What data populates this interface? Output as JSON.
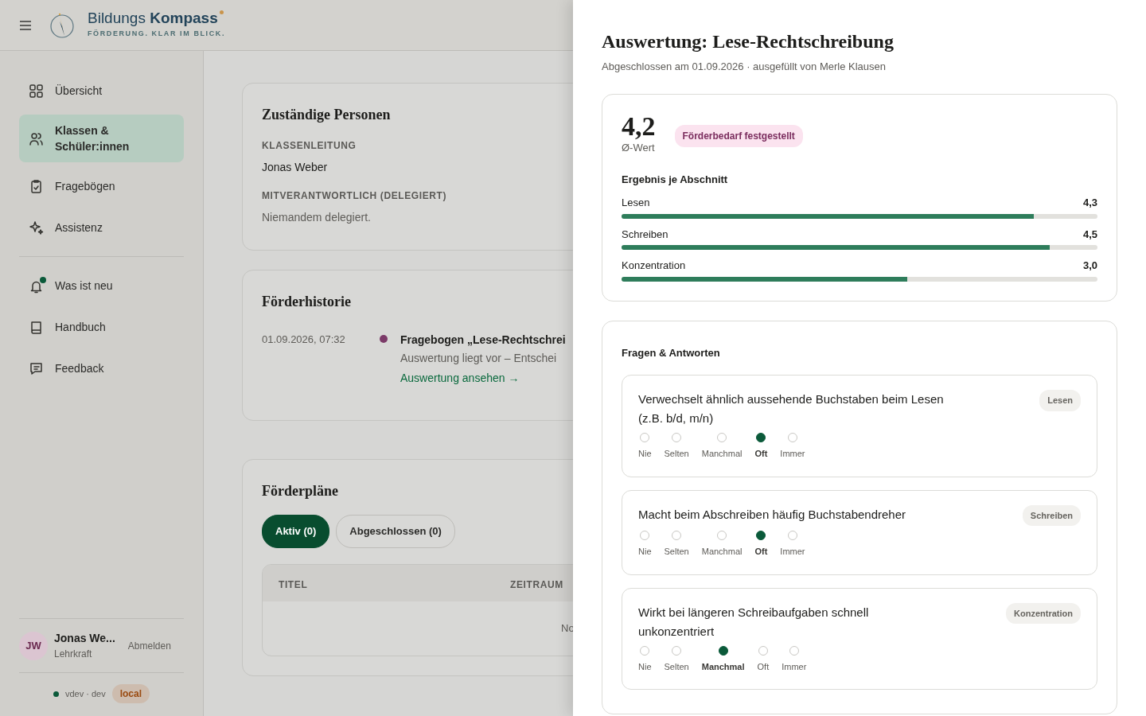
{
  "header": {
    "brand": "Bildungs **Kompass**",
    "tagline": "FÖRDERUNG. KLAR IM BLICK."
  },
  "sidebar": {
    "items": [
      {
        "label": "Übersicht",
        "selected": false,
        "has_news": false
      },
      {
        "label": "Klassen & Schüler:innen",
        "selected": true,
        "has_news": false
      },
      {
        "label": "Fragebögen",
        "selected": false,
        "has_news": false
      },
      {
        "label": "Assistenz",
        "selected": false,
        "has_news": false
      },
      {
        "label": "Was ist neu",
        "selected": false,
        "has_news": true
      },
      {
        "label": "Handbuch",
        "selected": false,
        "has_news": false
      },
      {
        "label": "Feedback",
        "selected": false,
        "has_news": false
      }
    ],
    "user": {
      "initials": "JW",
      "name": "Jonas We...",
      "role": "Lehrkraft",
      "logout": "Abmelden"
    },
    "build": {
      "version": "vdev · dev",
      "environment": "local"
    }
  },
  "persons": {
    "title": "Zuständige Personen",
    "fields": [
      {
        "label": "KLASSENLEITUNG",
        "value": "Jonas Weber",
        "muted": false
      },
      {
        "label": "MITVERANTWORTLICH (DELEGIERT)",
        "value": "Niemandem delegiert.",
        "muted": true
      }
    ]
  },
  "history": {
    "title": "Förderhistorie",
    "entries": [
      {
        "time": "01.09.2026, 07:32",
        "color": "#7b3a68",
        "title": "Fragebogen „Lese-Rechtschrei",
        "text": "Auswertung liegt vor – Entschei",
        "link": "Auswertung ansehen →"
      }
    ]
  },
  "plans": {
    "title": "Förderpläne",
    "filters": [
      {
        "label": "Aktiv (0)",
        "selected": true
      },
      {
        "label": "Abgeschlossen (0)",
        "selected": false
      }
    ],
    "table": {
      "columns": [
        "TITEL",
        "ZEITRAUM"
      ],
      "empty_text": "No"
    }
  },
  "drawer": {
    "title": "Auswertung: Lese-Rechtschreibung",
    "subtitle": "Abgeschlossen am 01.09.2026 · ausgefüllt von Merle Klausen",
    "score": "4,2",
    "score_label": "Ø-Wert",
    "status": "Förderbedarf festgestellt",
    "sections_title": "Ergebnis je Abschnitt",
    "sections": [
      {
        "name": "Lesen",
        "value": "4,3",
        "level": 0.866
      },
      {
        "name": "Schreiben",
        "value": "4,5",
        "level": 0.9
      },
      {
        "name": "Konzentration",
        "value": "3,0",
        "level": 0.6
      }
    ],
    "questions_title": "Fragen & Antworten",
    "questions": [
      {
        "text": "Verwechselt ähnlich aussehende Buchstaben beim Lesen (z.B. b/d, m/n)",
        "tag": "Lesen",
        "options": [
          {
            "label": "Nie",
            "selected": false
          },
          {
            "label": "Selten",
            "selected": false
          },
          {
            "label": "Manchmal",
            "selected": false
          },
          {
            "label": "Oft",
            "selected": true
          },
          {
            "label": "Immer",
            "selected": false
          }
        ]
      },
      {
        "text": "Macht beim Abschreiben häufig Buchstabendreher",
        "tag": "Schreiben",
        "options": [
          {
            "label": "Nie",
            "selected": false
          },
          {
            "label": "Selten",
            "selected": false
          },
          {
            "label": "Manchmal",
            "selected": false
          },
          {
            "label": "Oft",
            "selected": true
          },
          {
            "label": "Immer",
            "selected": false
          }
        ]
      },
      {
        "text": "Wirkt bei längeren Schreibaufgaben schnell unkonzentriert",
        "tag": "Konzentration",
        "options": [
          {
            "label": "Nie",
            "selected": false
          },
          {
            "label": "Selten",
            "selected": false
          },
          {
            "label": "Manchmal",
            "selected": true
          },
          {
            "label": "Oft",
            "selected": false
          },
          {
            "label": "Immer",
            "selected": false
          }
        ]
      }
    ]
  }
}
